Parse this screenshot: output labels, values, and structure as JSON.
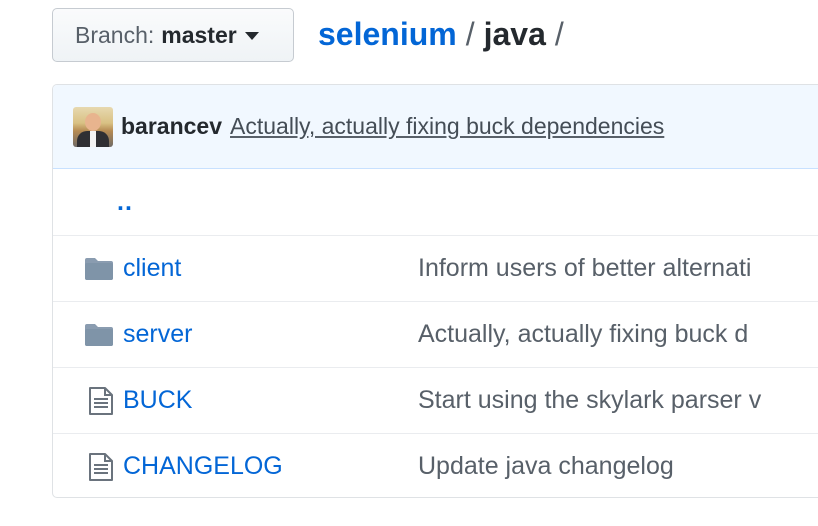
{
  "branch": {
    "prefix": "Branch:",
    "name": "master"
  },
  "breadcrumb": {
    "repo": "selenium",
    "separator": "/",
    "current": "java",
    "trailing": "/"
  },
  "latest_commit": {
    "author": "barancev",
    "message": "Actually, actually fixing buck dependencies"
  },
  "parent_link": "..",
  "files": [
    {
      "type": "folder",
      "icon": "folder-icon",
      "name": "client",
      "message": "Inform users of better alternati"
    },
    {
      "type": "folder",
      "icon": "folder-icon",
      "name": "server",
      "message": "Actually, actually fixing buck d"
    },
    {
      "type": "file",
      "icon": "file-icon",
      "name": "BUCK",
      "message": "Start using the skylark parser v"
    },
    {
      "type": "file",
      "icon": "file-icon",
      "name": "CHANGELOG",
      "message": "Update java changelog"
    }
  ],
  "colors": {
    "link": "#0366d6",
    "folder": "#79b8ff",
    "commit_bar_bg": "#f1f8ff"
  }
}
